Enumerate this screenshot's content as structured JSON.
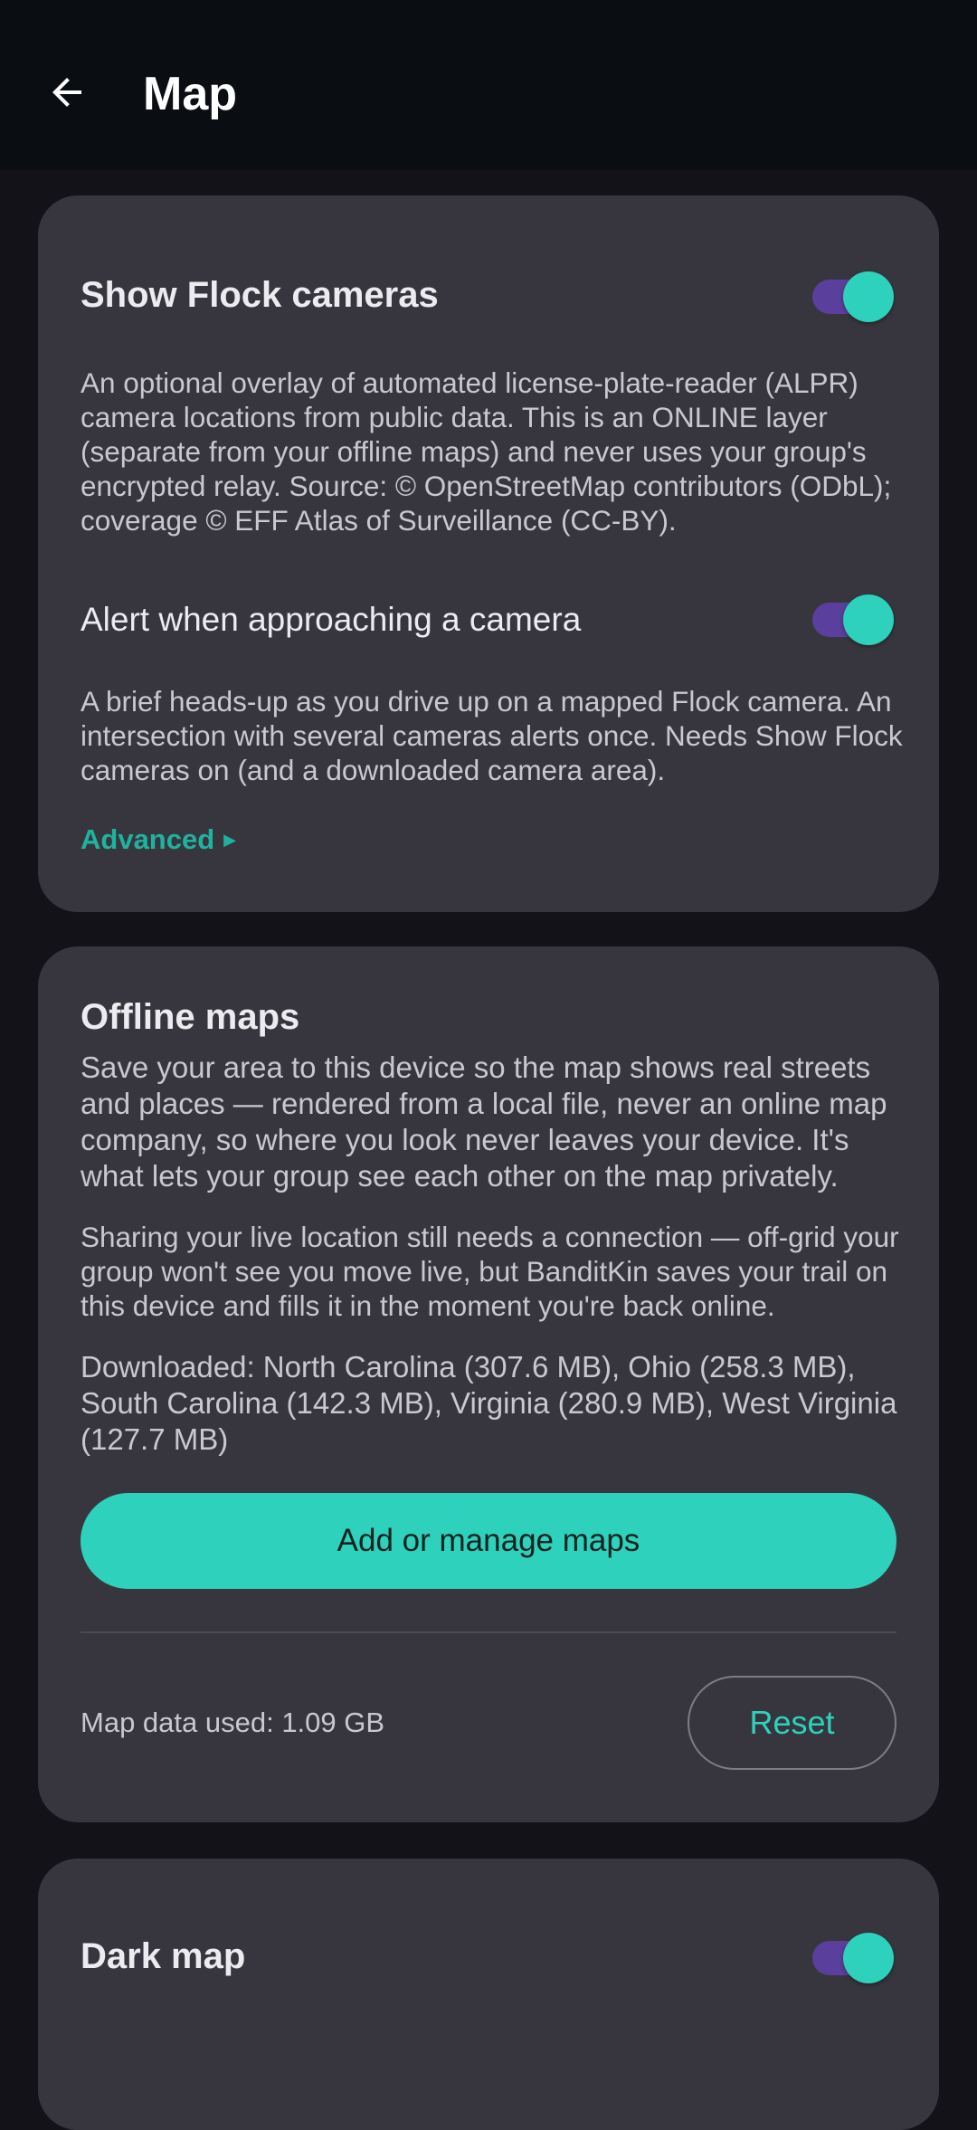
{
  "appbar": {
    "back_icon": "arrow-left-icon",
    "title": "Map"
  },
  "flock": {
    "show_title": "Show Flock cameras",
    "show_enabled": true,
    "show_description": "An optional overlay of automated license-plate-reader (ALPR) camera locations from public data. This is an ONLINE layer (separate from your offline maps) and never uses your group's encrypted relay. Source: © OpenStreetMap contributors (ODbL); coverage © EFF Atlas of Surveillance (CC-BY).",
    "alert_label": "Alert when approaching a camera",
    "alert_enabled": true,
    "alert_description": "A brief heads-up as you drive up on a mapped Flock camera. An intersection with several cameras alerts once. Needs Show Flock cameras on (and a downloaded camera area).",
    "advanced_label": "Advanced",
    "advanced_icon": "triangle-right-icon"
  },
  "offline": {
    "title": "Offline maps",
    "description": "Save your area to this device so the map shows real streets and places — rendered from a local file, never an online map company, so where you look never leaves your device. It's what lets your group see each other on the map privately.",
    "sharing_note": "Sharing your live location still needs a connection — off-grid your group won't see you move live, but BanditKin saves your trail on this device and fills it in the moment you're back online.",
    "downloaded": "Downloaded: North Carolina (307.6 MB), Ohio (258.3 MB), South Carolina (142.3 MB), Virginia (280.9 MB), West Virginia (127.7 MB)",
    "manage_button": "Add or manage maps",
    "usage": "Map data used: 1.09 GB",
    "reset_button": "Reset"
  },
  "dark_map": {
    "title": "Dark map",
    "enabled": true
  },
  "colors": {
    "accent": "#2ed1bc",
    "toggle_track": "#5a3f9c",
    "card": "#37363e",
    "background": "#131218"
  }
}
